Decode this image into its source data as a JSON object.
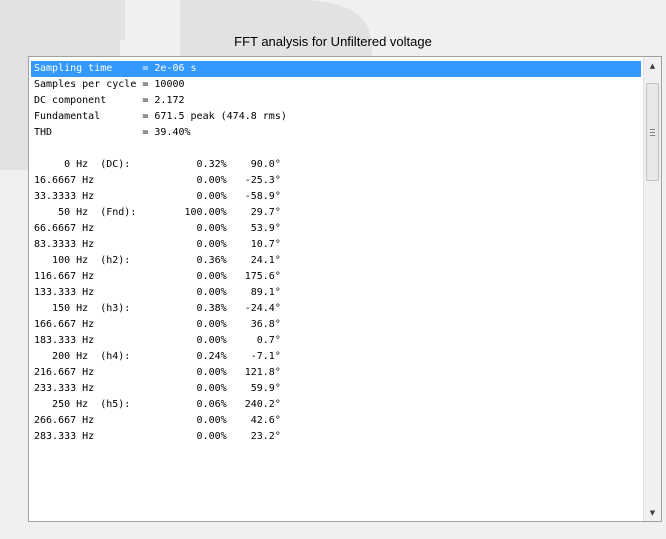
{
  "window": {
    "title": "FFT analysis for Unfiltered voltage"
  },
  "colors": {
    "selection": "#3399ff",
    "watermark": "#e2e2e2"
  },
  "lines": [
    "Sampling time     = 2e-06 s",
    "Samples per cycle = 10000",
    "DC component      = 2.172",
    "Fundamental       = 671.5 peak (474.8 rms)",
    "THD               = 39.40%",
    "",
    "     0 Hz  (DC):           0.32%    90.0°",
    "16.6667 Hz                 0.00%   -25.3°",
    "33.3333 Hz                 0.00%   -58.9°",
    "    50 Hz  (Fnd):        100.00%    29.7°",
    "66.6667 Hz                 0.00%    53.9°",
    "83.3333 Hz                 0.00%    10.7°",
    "   100 Hz  (h2):           0.36%    24.1°",
    "116.667 Hz                 0.00%   175.6°",
    "133.333 Hz                 0.00%    89.1°",
    "   150 Hz  (h3):           0.38%   -24.4°",
    "166.667 Hz                 0.00%    36.8°",
    "183.333 Hz                 0.00%     0.7°",
    "   200 Hz  (h4):           0.24%    -7.1°",
    "216.667 Hz                 0.00%   121.8°",
    "233.333 Hz                 0.00%    59.9°",
    "   250 Hz  (h5):           0.06%   240.2°",
    "266.667 Hz                 0.00%    42.6°",
    "283.333 Hz                 0.00%    23.2°"
  ],
  "selected_index": 0,
  "scrollbar": {
    "up_icon": "arrow-up-icon",
    "down_icon": "arrow-down-icon"
  }
}
